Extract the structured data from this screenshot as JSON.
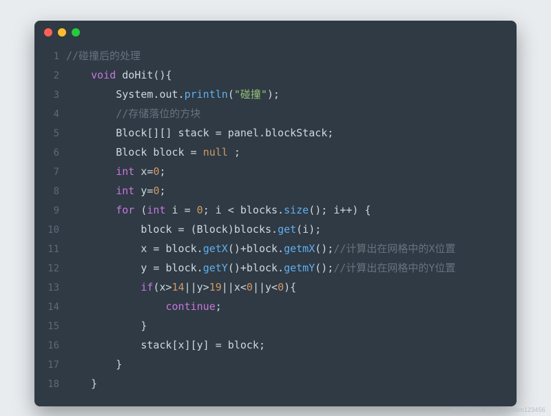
{
  "window": {
    "controls": [
      "close",
      "minimize",
      "zoom"
    ]
  },
  "watermark": "https://blog.csdn.net/dkm123456",
  "code": {
    "language": "java",
    "lines": [
      {
        "n": 1,
        "indent": 0,
        "tokens": [
          {
            "t": "//碰撞后的处理",
            "c": "c-comment"
          }
        ]
      },
      {
        "n": 2,
        "indent": 1,
        "tokens": [
          {
            "t": "void",
            "c": "c-keyword"
          },
          {
            "t": " doHit(){",
            "c": "src"
          }
        ]
      },
      {
        "n": 3,
        "indent": 2,
        "tokens": [
          {
            "t": "System.",
            "c": "src"
          },
          {
            "t": "out",
            "c": "c-builtin"
          },
          {
            "t": ".",
            "c": "src"
          },
          {
            "t": "println",
            "c": "c-call"
          },
          {
            "t": "(",
            "c": "src"
          },
          {
            "t": "\"碰撞\"",
            "c": "c-string"
          },
          {
            "t": ");",
            "c": "src"
          }
        ]
      },
      {
        "n": 4,
        "indent": 2,
        "tokens": [
          {
            "t": "//存储落位的方块",
            "c": "c-comment"
          }
        ]
      },
      {
        "n": 5,
        "indent": 2,
        "tokens": [
          {
            "t": "Block[][] stack = panel.blockStack;",
            "c": "src"
          }
        ]
      },
      {
        "n": 6,
        "indent": 2,
        "tokens": [
          {
            "t": "Block block = ",
            "c": "src"
          },
          {
            "t": "null",
            "c": "c-const"
          },
          {
            "t": " ;",
            "c": "src"
          }
        ]
      },
      {
        "n": 7,
        "indent": 2,
        "tokens": [
          {
            "t": "int",
            "c": "c-keyword"
          },
          {
            "t": " x=",
            "c": "src"
          },
          {
            "t": "0",
            "c": "c-number"
          },
          {
            "t": ";",
            "c": "src"
          }
        ]
      },
      {
        "n": 8,
        "indent": 2,
        "tokens": [
          {
            "t": "int",
            "c": "c-keyword"
          },
          {
            "t": " y=",
            "c": "src"
          },
          {
            "t": "0",
            "c": "c-number"
          },
          {
            "t": ";",
            "c": "src"
          }
        ]
      },
      {
        "n": 9,
        "indent": 2,
        "tokens": [
          {
            "t": "for",
            "c": "c-keyword"
          },
          {
            "t": " (",
            "c": "src"
          },
          {
            "t": "int",
            "c": "c-keyword"
          },
          {
            "t": " i = ",
            "c": "src"
          },
          {
            "t": "0",
            "c": "c-number"
          },
          {
            "t": "; i < blocks.",
            "c": "src"
          },
          {
            "t": "size",
            "c": "c-call"
          },
          {
            "t": "(); i++) {",
            "c": "src"
          }
        ]
      },
      {
        "n": 10,
        "indent": 3,
        "tokens": [
          {
            "t": "block = (Block)blocks.",
            "c": "src"
          },
          {
            "t": "get",
            "c": "c-call"
          },
          {
            "t": "(i);",
            "c": "src"
          }
        ]
      },
      {
        "n": 11,
        "indent": 3,
        "tokens": [
          {
            "t": "x = block.",
            "c": "src"
          },
          {
            "t": "getX",
            "c": "c-call"
          },
          {
            "t": "()+block.",
            "c": "src"
          },
          {
            "t": "getmX",
            "c": "c-call"
          },
          {
            "t": "();",
            "c": "src"
          },
          {
            "t": "//计算出在网格中的X位置",
            "c": "c-comment"
          }
        ]
      },
      {
        "n": 12,
        "indent": 3,
        "tokens": [
          {
            "t": "y = block.",
            "c": "src"
          },
          {
            "t": "getY",
            "c": "c-call"
          },
          {
            "t": "()+block.",
            "c": "src"
          },
          {
            "t": "getmY",
            "c": "c-call"
          },
          {
            "t": "();",
            "c": "src"
          },
          {
            "t": "//计算出在网格中的Y位置",
            "c": "c-comment"
          }
        ]
      },
      {
        "n": 13,
        "indent": 3,
        "tokens": [
          {
            "t": "if",
            "c": "c-keyword"
          },
          {
            "t": "(x>",
            "c": "src"
          },
          {
            "t": "14",
            "c": "c-number"
          },
          {
            "t": "||y>",
            "c": "src"
          },
          {
            "t": "19",
            "c": "c-number"
          },
          {
            "t": "||x<",
            "c": "src"
          },
          {
            "t": "0",
            "c": "c-number"
          },
          {
            "t": "||y<",
            "c": "src"
          },
          {
            "t": "0",
            "c": "c-number"
          },
          {
            "t": "){",
            "c": "src"
          }
        ]
      },
      {
        "n": 14,
        "indent": 4,
        "tokens": [
          {
            "t": "continue",
            "c": "c-keyword"
          },
          {
            "t": ";",
            "c": "src"
          }
        ]
      },
      {
        "n": 15,
        "indent": 3,
        "tokens": [
          {
            "t": "}",
            "c": "src"
          }
        ]
      },
      {
        "n": 16,
        "indent": 3,
        "tokens": [
          {
            "t": "stack[x][y] = block;",
            "c": "src"
          }
        ]
      },
      {
        "n": 17,
        "indent": 2,
        "tokens": [
          {
            "t": "}",
            "c": "src"
          }
        ]
      },
      {
        "n": 18,
        "indent": 1,
        "tokens": [
          {
            "t": "}",
            "c": "src"
          }
        ]
      }
    ]
  }
}
